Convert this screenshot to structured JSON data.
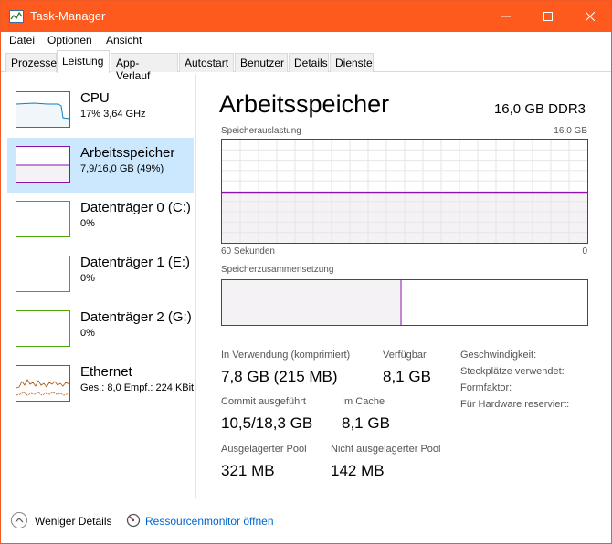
{
  "window": {
    "title": "Task-Manager",
    "accent_color": "#fe5a1d",
    "controls": {
      "minimize": "minimize-icon",
      "maximize": "maximize-icon",
      "close": "close-icon"
    }
  },
  "menu": [
    "Datei",
    "Optionen",
    "Ansicht"
  ],
  "tabs": [
    "Prozesse",
    "Leistung",
    "App-Verlauf",
    "Autostart",
    "Benutzer",
    "Details",
    "Dienste"
  ],
  "active_tab": "Leistung",
  "sidebar": {
    "items": [
      {
        "name": "CPU",
        "detail": "17% 3,64 GHz",
        "color": "#117dbb",
        "selected": false
      },
      {
        "name": "Arbeitsspeicher",
        "detail": "7,9/16,0 GB (49%)",
        "color": "#8b12ae",
        "selected": true
      },
      {
        "name": "Datenträger 0 (C:)",
        "detail": "0%",
        "color": "#4da60c",
        "selected": false
      },
      {
        "name": "Datenträger 1 (E:)",
        "detail": "0%",
        "color": "#4da60c",
        "selected": false
      },
      {
        "name": "Datenträger 2 (G:)",
        "detail": "0%",
        "color": "#4da60c",
        "selected": false
      },
      {
        "name": "Ethernet",
        "detail": "Ges.: 8,0 Empf.: 224 KBit",
        "color": "#a74f01",
        "selected": false
      }
    ]
  },
  "main": {
    "title": "Arbeitsspeicher",
    "spec": "16,0 GB DDR3",
    "usage_chart": {
      "label": "Speicherauslastung",
      "max_label": "16,0 GB",
      "time_label": "60 Sekunden",
      "min_label": "0",
      "usage_fraction": 0.49,
      "line_color": "#8b12ae",
      "fill_color": "#f4f2f4"
    },
    "composition": {
      "label": "Speicherzusammensetzung",
      "in_use_fraction": 0.49
    },
    "stats": [
      {
        "label": "In Verwendung (komprimiert)",
        "value": "7,8 GB (215 MB)"
      },
      {
        "label": "Verfügbar",
        "value": "8,1 GB"
      },
      {
        "label": "Commit ausgeführt",
        "value": "10,5/18,3 GB"
      },
      {
        "label": "Im Cache",
        "value": "8,1 GB"
      },
      {
        "label": "Ausgelagerter Pool",
        "value": "321 MB"
      },
      {
        "label": "Nicht ausgelagerter Pool",
        "value": "142 MB"
      }
    ],
    "properties": [
      "Geschwindigkeit:",
      "Steckplätze verwendet:",
      "Formfaktor:",
      "Für Hardware reserviert:"
    ]
  },
  "footer": {
    "less_details": "Weniger Details",
    "resource_monitor": "Ressourcenmonitor öffnen"
  }
}
